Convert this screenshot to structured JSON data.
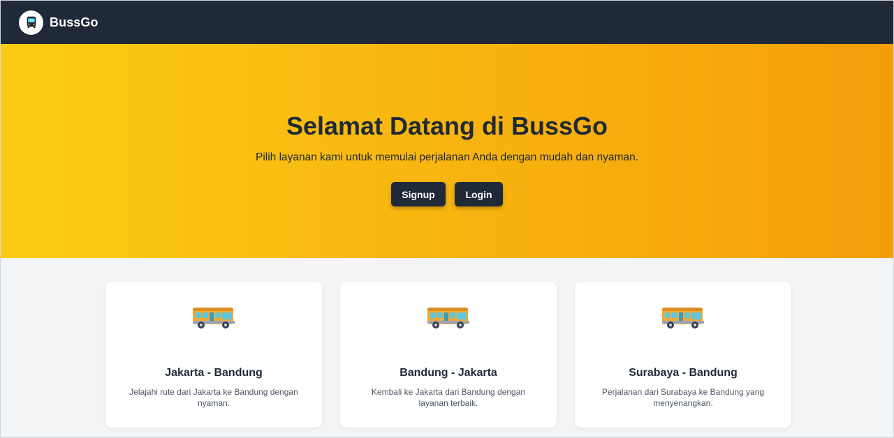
{
  "navbar": {
    "brand": "BussGo",
    "logo_icon": "bus-icon"
  },
  "hero": {
    "title": "Selamat Datang di BussGo",
    "subtitle": "Pilih layanan kami untuk memulai perjalanan Anda dengan mudah dan nyaman.",
    "signup_label": "Signup",
    "login_label": "Login"
  },
  "cards": [
    {
      "icon": "bus-icon",
      "title": "Jakarta - Bandung",
      "description": "Jelajahi rute dari Jakarta ke Bandung dengan nyaman."
    },
    {
      "icon": "bus-icon",
      "title": "Bandung - Jakarta",
      "description": "Kembali ke Jakarta dari Bandung dengan layanan terbaik."
    },
    {
      "icon": "bus-icon",
      "title": "Surabaya - Bandung",
      "description": "Perjalanan dari Surabaya ke Bandung yang menyenangkan."
    }
  ],
  "colors": {
    "navbar_bg": "#1f2937",
    "hero_gradient_start": "#facc15",
    "hero_gradient_end": "#f59e0b",
    "button_bg": "#1f2937",
    "page_bg": "#f3f4f6",
    "card_bg": "#ffffff"
  }
}
